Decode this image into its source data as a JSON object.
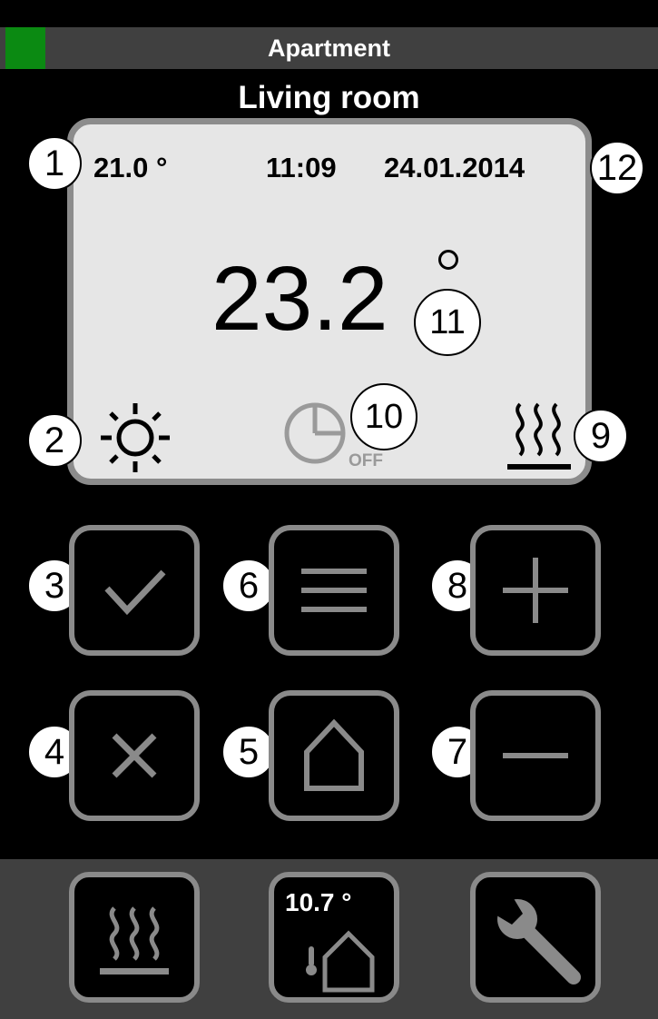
{
  "header": {
    "title": "Apartment",
    "status_color": "#0b8a12"
  },
  "room": {
    "name": "Living room"
  },
  "display": {
    "setpoint": "21.0 °",
    "time": "11:09",
    "date": "24.01.2014",
    "current_temperature": "23.2",
    "timer_status": "OFF",
    "mode_icon": "sun-icon",
    "timer_icon": "clock-off-icon",
    "heating_icon": "heating-icon"
  },
  "callouts": [
    "1",
    "2",
    "3",
    "4",
    "5",
    "6",
    "7",
    "8",
    "9",
    "10",
    "11",
    "12"
  ],
  "buttons": {
    "confirm": "check-icon",
    "cancel": "close-icon",
    "menu": "menu-icon",
    "home": "home-icon",
    "increase": "plus-icon",
    "decrease": "minus-icon"
  },
  "footer": {
    "heating_icon": "heating-icon",
    "outdoor_temperature": "10.7 °",
    "outdoor_icon": "thermometer-house-icon",
    "settings_icon": "wrench-icon"
  },
  "colors": {
    "background": "#000000",
    "header_bar": "#404040",
    "display_bg": "#e6e6e6",
    "button_border": "#8a8a8a",
    "status_led": "#0b8a12"
  }
}
